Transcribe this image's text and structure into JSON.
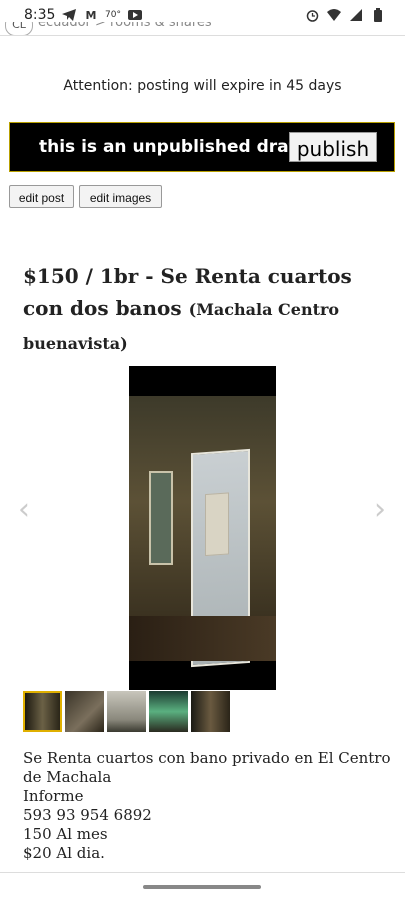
{
  "status": {
    "time": "8:35",
    "left_icons": [
      "telegram-icon",
      "gmail-icon",
      "weather-icon",
      "youtube-icon"
    ],
    "temp": "70°",
    "gmail_letter": "M",
    "right_icons": [
      "alarm-icon",
      "wifi-icon",
      "signal-icon",
      "battery-icon"
    ]
  },
  "header": {
    "logo": "CL",
    "breadcrumb": "ecuador > rooms & shares"
  },
  "attention": "Attention: posting will expire in 45 days",
  "draft": {
    "message": "this is an unpublished draft.",
    "publish_label": "publish"
  },
  "edit": {
    "post_label": "edit post",
    "images_label": "edit images"
  },
  "listing": {
    "title": "$150 / 1br - Se Renta cuartos con dos banos",
    "location": "(Machala Centro buenavista)"
  },
  "gallery": {
    "prev": "‹",
    "next": "›",
    "thumb_count": 5,
    "selected_index": 0
  },
  "description": [
    "Se Renta cuartos con bano privado en El Centro de Machala",
    "Informe",
    "593 93 954 6892",
    "150 Al mes",
    "$20 Al dia."
  ]
}
